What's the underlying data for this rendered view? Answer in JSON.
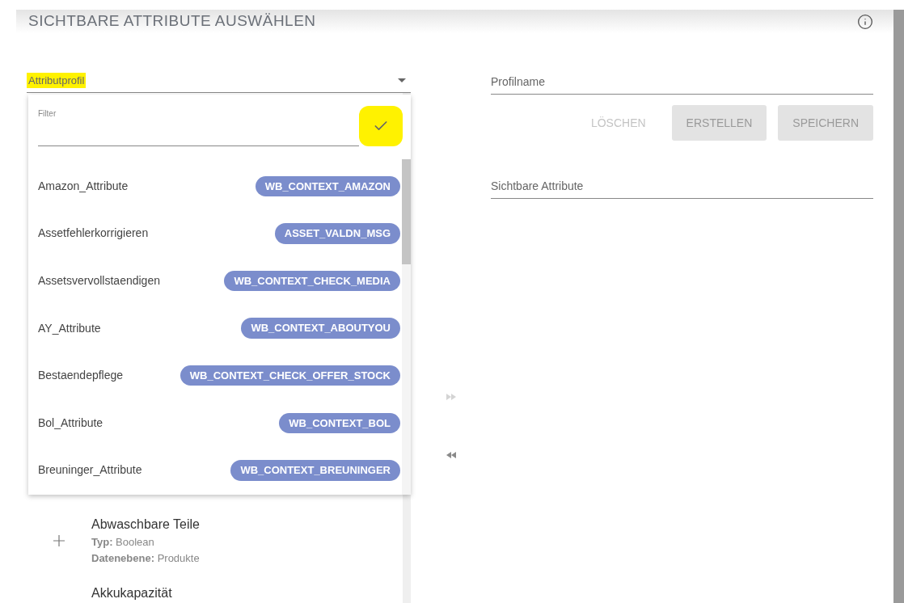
{
  "header": {
    "title": "SICHTBARE ATTRIBUTE AUSWÄHLEN"
  },
  "profile_select": {
    "label": "Attributprofil",
    "highlighted": true,
    "expanded": true
  },
  "dropdown": {
    "filter": {
      "label": "Filter",
      "confirm_highlighted": true
    },
    "items": [
      {
        "name": "Amazon_Attribute",
        "tag": "WB_CONTEXT_AMAZON"
      },
      {
        "name": "Assetfehlerkorrigieren",
        "tag": "ASSET_VALDN_MSG"
      },
      {
        "name": "Assetsvervollstaendigen",
        "tag": "WB_CONTEXT_CHECK_MEDIA"
      },
      {
        "name": "AY_Attribute",
        "tag": "WB_CONTEXT_ABOUTYOU"
      },
      {
        "name": "Bestaendepflege",
        "tag": "WB_CONTEXT_CHECK_OFFER_STOCK"
      },
      {
        "name": "Bol_Attribute",
        "tag": "WB_CONTEXT_BOL"
      },
      {
        "name": "Breuninger_Attribute",
        "tag": "WB_CONTEXT_BREUNINGER"
      }
    ]
  },
  "attributes": [
    {
      "name": "Abwaschbare Teile",
      "type": "**Typ:** Boolean",
      "data_level": "**Datenebene:** Produkte"
    },
    {
      "name": "Akkukapazität"
    }
  ],
  "transfer_buttons": [
    {
      "kind": "add",
      "disabled": true
    },
    {
      "kind": "remove",
      "disabled": false
    }
  ],
  "profile_name": {
    "placeholder": "Profilname"
  },
  "actions": [
    {
      "label": "LÖSCHEN",
      "kind": "text",
      "disabled": true
    },
    {
      "label": "ERSTELLEN",
      "kind": "filled",
      "disabled": true
    },
    {
      "label": "SPEICHERN",
      "kind": "filled",
      "disabled": true
    }
  ],
  "visible_attributes": {
    "placeholder": "Sichtbare Attribute"
  }
}
